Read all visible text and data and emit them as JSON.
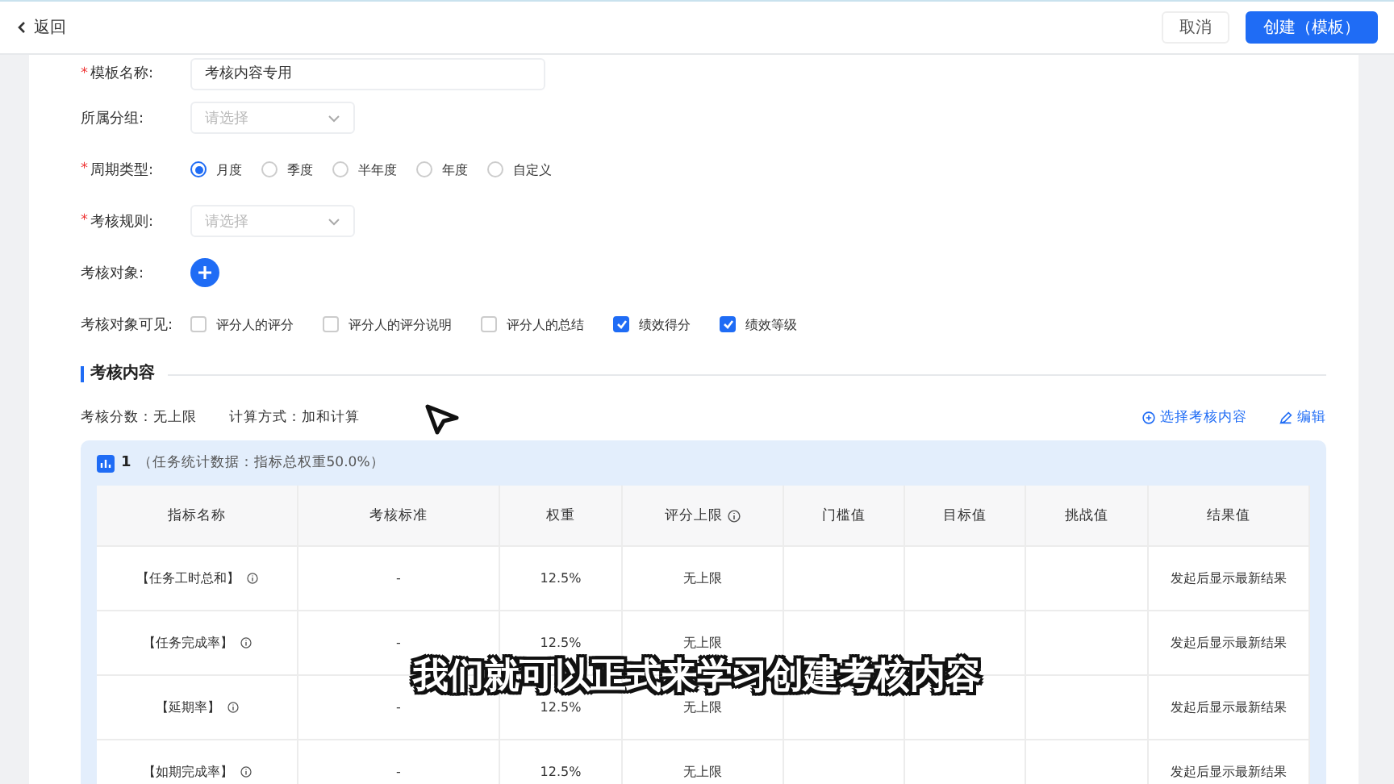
{
  "header": {
    "back": "返回",
    "cancel": "取消",
    "create": "创建（模板）"
  },
  "form": {
    "name": {
      "label": "模板名称:",
      "mark": "*",
      "value": "考核内容专用"
    },
    "group": {
      "label": "所属分组:",
      "placeholder": "请选择"
    },
    "cycle": {
      "label": "周期类型:",
      "mark": "*",
      "options": [
        {
          "label": "月度",
          "selected": true
        },
        {
          "label": "季度",
          "selected": false
        },
        {
          "label": "半年度",
          "selected": false
        },
        {
          "label": "年度",
          "selected": false
        },
        {
          "label": "自定义",
          "selected": false
        }
      ]
    },
    "rule": {
      "label": "考核规则:",
      "mark": "*",
      "placeholder": "请选择"
    },
    "target": {
      "label": "考核对象:"
    },
    "visible": {
      "label": "考核对象可见:",
      "options": [
        {
          "label": "评分人的评分",
          "checked": false
        },
        {
          "label": "评分人的评分说明",
          "checked": false
        },
        {
          "label": "评分人的总结",
          "checked": false
        },
        {
          "label": "绩效得分",
          "checked": true
        },
        {
          "label": "绩效等级",
          "checked": true
        }
      ]
    }
  },
  "section": {
    "title": "考核内容",
    "score": "考核分数：无上限",
    "method": "计算方式：加和计算",
    "select_link": "选择考核内容",
    "edit_link": "编辑"
  },
  "group_card": {
    "index": "1",
    "title": "（任务统计数据：指标总权重50.0%）",
    "columns": [
      {
        "label": "指标名称",
        "info": false
      },
      {
        "label": "考核标准",
        "info": false
      },
      {
        "label": "权重",
        "info": false
      },
      {
        "label": "评分上限",
        "info": true
      },
      {
        "label": "门槛值",
        "info": false
      },
      {
        "label": "目标值",
        "info": false
      },
      {
        "label": "挑战值",
        "info": false
      },
      {
        "label": "结果值",
        "info": false
      }
    ],
    "rows": [
      {
        "name": "【任务工时总和】",
        "standard": "-",
        "weight": "12.5%",
        "cap": "无上限",
        "result": "发起后显示最新结果"
      },
      {
        "name": "【任务完成率】",
        "standard": "-",
        "weight": "12.5%",
        "cap": "无上限",
        "result": "发起后显示最新结果"
      },
      {
        "name": "【延期率】",
        "standard": "-",
        "weight": "12.5%",
        "cap": "无上限",
        "result": "发起后显示最新结果"
      },
      {
        "name": "【如期完成率】",
        "standard": "-",
        "weight": "12.5%",
        "cap": "无上限",
        "result": "发起后显示最新结果"
      }
    ]
  },
  "subtitle": "我们就可以正式来学习创建考核内容"
}
